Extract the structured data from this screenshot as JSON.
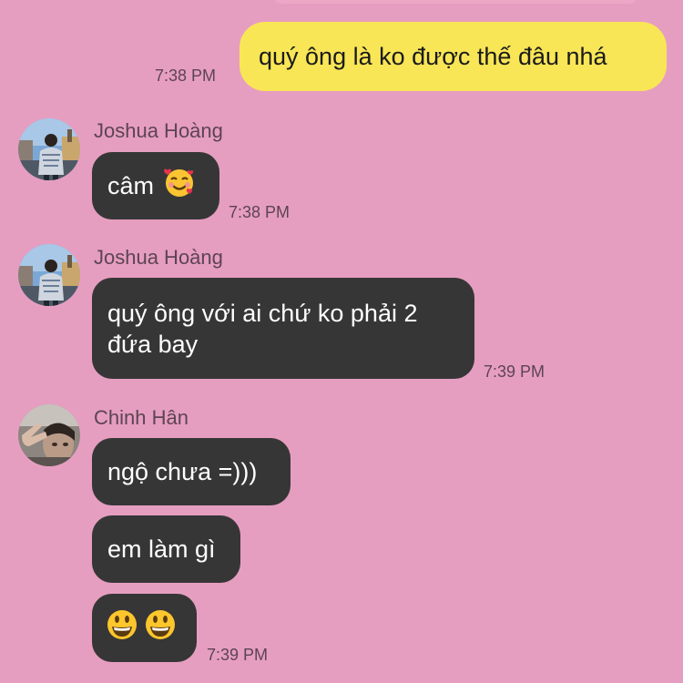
{
  "messages": [
    {
      "text": "quý ông là ko được thế đâu nhá",
      "time": "7:38 PM"
    },
    {
      "sender": "Joshua Hoàng",
      "text": "câm",
      "emoji": "smiling-face-with-hearts",
      "time": "7:38 PM"
    },
    {
      "sender": "Joshua Hoàng",
      "text_line1": "quý ông với ai chứ ko phải 2",
      "text_line2": "đứa bay",
      "time": "7:39 PM"
    },
    {
      "sender": "Chinh Hân",
      "text": "ngộ chưa =)))"
    },
    {
      "text": "em làm gì"
    },
    {
      "emoji": "grinning-face-pair",
      "time": "7:39 PM"
    }
  ],
  "colors": {
    "background": "#e69ec0",
    "outgoing_bubble": "#f9e656",
    "incoming_bubble": "#363636",
    "meta_text": "#5d4452"
  }
}
